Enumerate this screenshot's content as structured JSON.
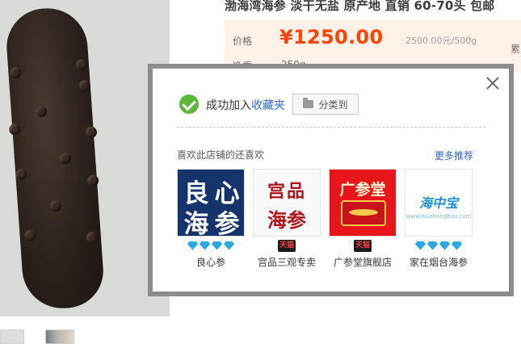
{
  "product": {
    "title": "渤海湾海参 淡干无盐 原产地 直销 60-70头 包邮",
    "price_label": "价格",
    "price": "¥1250.00",
    "unit_price": "2500.00元/500g",
    "right_clip": "累",
    "weight_label": "净重",
    "weight_value": "250g"
  },
  "modal": {
    "success_prefix": "成功加入",
    "success_link": "收藏夹",
    "categorize_label": "分类到",
    "recommend_heading": "喜欢此店铺的还喜欢",
    "more_link": "更多推荐",
    "shops": [
      {
        "name": "良心参",
        "badge": "diamond-x4",
        "logo_chars": [
          "良",
          "心",
          "海",
          "参"
        ]
      },
      {
        "name": "宫品三观专卖",
        "badge": "天猫",
        "logo_top": "宫品",
        "logo_bottom": "海参"
      },
      {
        "name": "广参堂旗舰店",
        "badge": "天猫",
        "logo_top": "广参堂"
      },
      {
        "name": "家在烟台海参",
        "badge": "diamond-x4",
        "logo_mark": "海中宝",
        "logo_sub": "www.haizhongbao.com"
      }
    ]
  },
  "colors": {
    "price": "#ff4400",
    "link": "#3366cc",
    "success": "#5bb83a",
    "diamond": "#2aa7e6"
  }
}
